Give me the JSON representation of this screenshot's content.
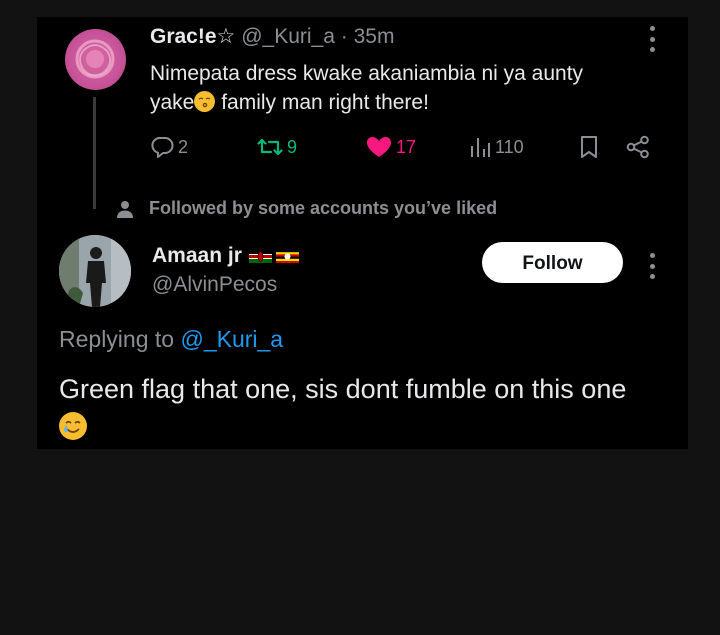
{
  "original_tweet": {
    "display_name": "Grac!e☆",
    "handle": "@_Kuri_a",
    "separator": "·",
    "time": "35m",
    "text_line1": "Nimepata dress kwake akaniambia ni ya aunty",
    "text_line2_before_emoji": "yake",
    "text_line2_after_emoji": " family man right there!",
    "replies": "2",
    "retweets": "9",
    "likes": "17",
    "views": "110"
  },
  "followed_notice": "Followed by some accounts you’ve liked",
  "reply_author": {
    "display_name": "Amaan jr",
    "handle": "@AlvinPecos",
    "follow_label": "Follow"
  },
  "replying_to": {
    "prefix": "Replying to ",
    "handle": "@_Kuri_a"
  },
  "reply_text": "Green flag that one, sis dont fumble on this one",
  "colors": {
    "background": "#121212",
    "card": "#000000",
    "text": "#e7e9ea",
    "muted": "#8b8f94",
    "retweet_green": "#00ba7c",
    "like_pink": "#f91880",
    "link_blue": "#1d9bf0",
    "follow_button_bg": "#ffffff"
  },
  "icons": [
    "reply-icon",
    "retweet-icon",
    "heart-icon",
    "views-icon",
    "bookmark-icon",
    "share-icon",
    "person-icon",
    "more-icon",
    "kenya-flag-icon",
    "uganda-flag-icon"
  ]
}
